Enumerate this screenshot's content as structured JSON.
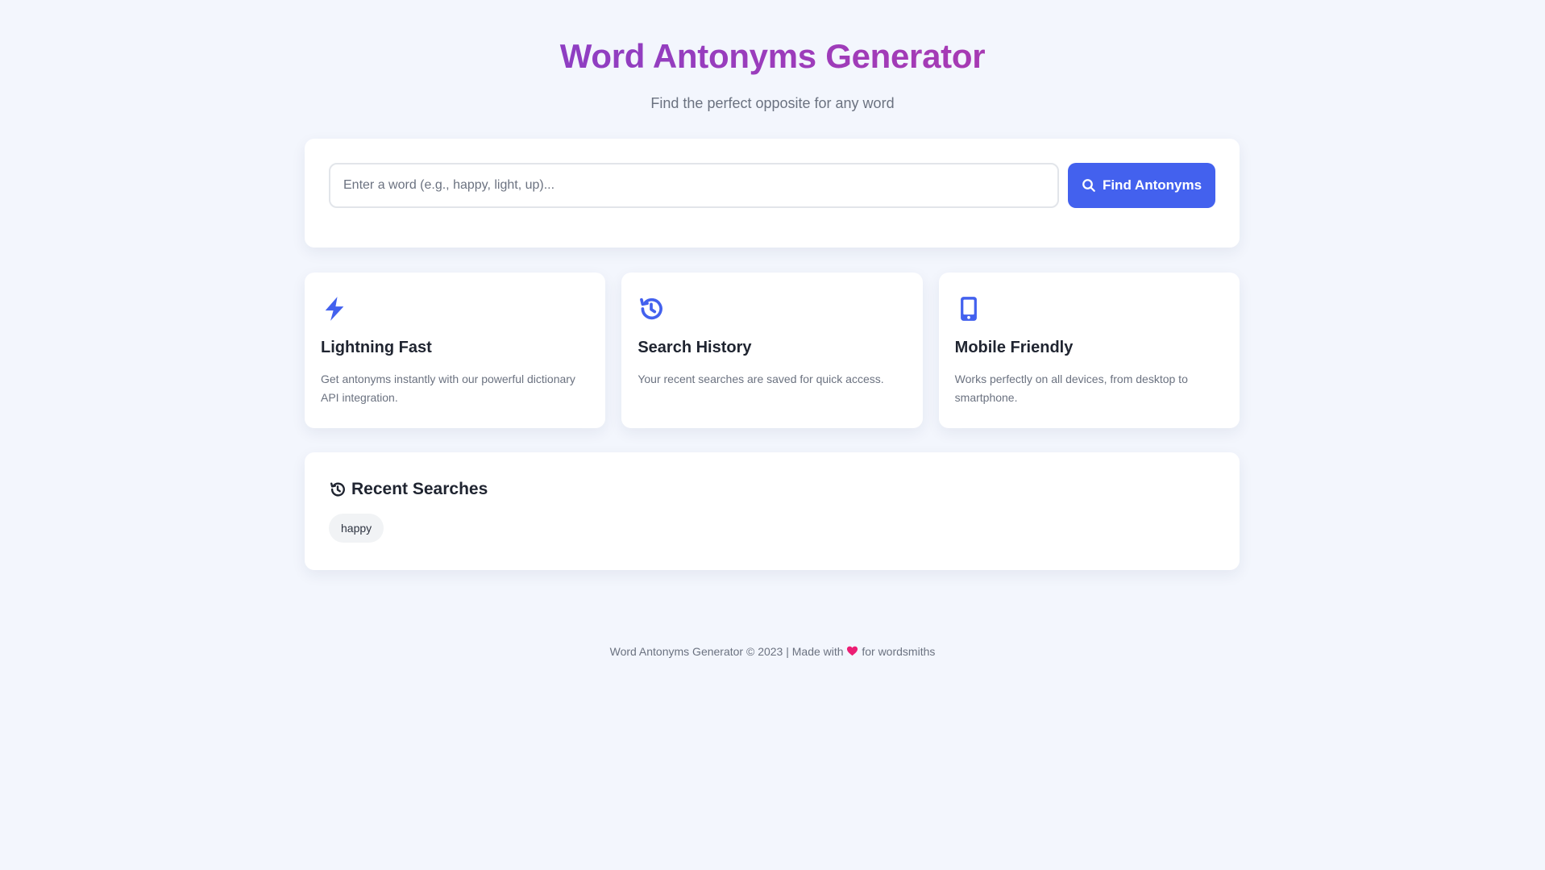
{
  "header": {
    "title": "Word Antonyms Generator",
    "subtitle": "Find the perfect opposite for any word"
  },
  "search": {
    "placeholder": "Enter a word (e.g., happy, light, up)...",
    "value": "",
    "button_label": "Find Antonyms",
    "button_icon": "search-icon"
  },
  "features": [
    {
      "icon": "lightning-icon",
      "title": "Lightning Fast",
      "description": "Get antonyms instantly with our powerful dictionary API integration."
    },
    {
      "icon": "history-icon",
      "title": "Search History",
      "description": "Your recent searches are saved for quick access."
    },
    {
      "icon": "mobile-icon",
      "title": "Mobile Friendly",
      "description": "Works perfectly on all devices, from desktop to smartphone."
    }
  ],
  "recent": {
    "heading": "Recent Searches",
    "icon": "history-icon",
    "items": [
      "happy"
    ]
  },
  "footer": {
    "text_before": "Word Antonyms Generator © 2023 | Made with",
    "icon": "heart-icon",
    "text_after": "for wordsmiths"
  },
  "colors": {
    "accent": "#4361ee",
    "background": "#f3f6fd",
    "title_gradient_start": "#6d44d6",
    "title_gradient_end": "#c1308f",
    "heart": "#ec1e74"
  }
}
